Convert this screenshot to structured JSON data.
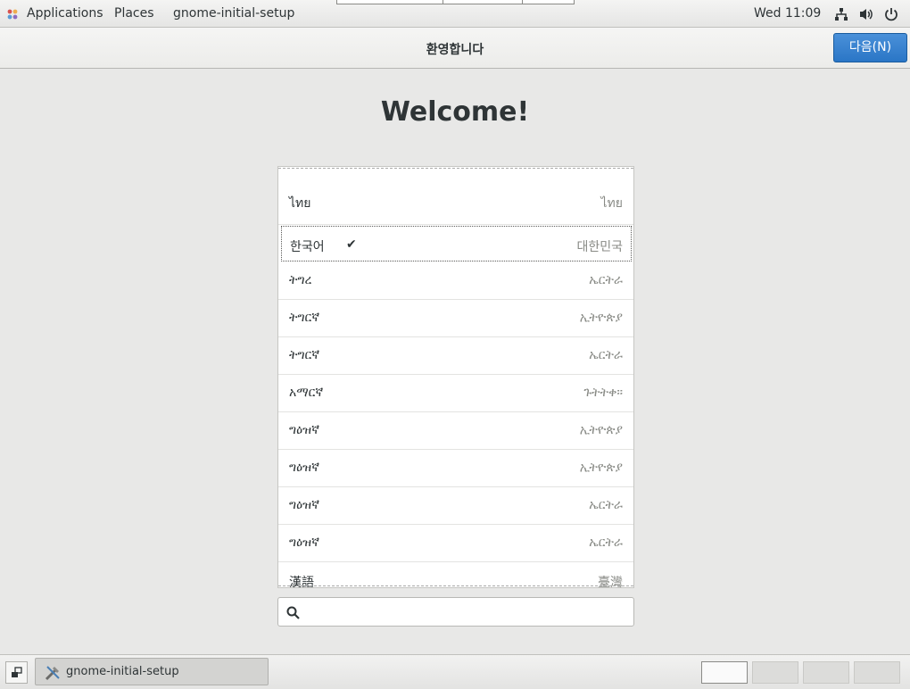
{
  "top_panel": {
    "applications": "Applications",
    "places": "Places",
    "app_name": "gnome-initial-setup",
    "clock": "Wed 11:09"
  },
  "header": {
    "title": "환영합니다",
    "next_button": "다음(N)"
  },
  "welcome": "Welcome!",
  "languages": [
    {
      "name": "ไทย",
      "region": "ไทย",
      "selected": false
    },
    {
      "name": "한국어",
      "region": "대한민국",
      "selected": true,
      "check": "✔"
    },
    {
      "name": "ትግረ",
      "region": "ኤርትራ",
      "selected": false
    },
    {
      "name": "ትግርኛ",
      "region": "ኢትዮጵያ",
      "selected": false
    },
    {
      "name": "ትግርኛ",
      "region": "ኤርትራ",
      "selected": false
    },
    {
      "name": "አማርኛ",
      "region": "ጉትትቀ።",
      "selected": false
    },
    {
      "name": "ግዕዝኛ",
      "region": "ኢትዮጵያ",
      "selected": false
    },
    {
      "name": "ግዕዝኛ",
      "region": "ኢትዮጵያ",
      "selected": false
    },
    {
      "name": "ግዕዝኛ",
      "region": "ኤርትራ",
      "selected": false
    },
    {
      "name": "ግዕዝኛ",
      "region": "ኤርትራ",
      "selected": false
    },
    {
      "name": "漢語",
      "region": "臺灣",
      "selected": false
    }
  ],
  "search": {
    "placeholder": ""
  },
  "taskbar": {
    "task_label": "gnome-initial-setup",
    "workspaces": 4,
    "active_workspace": 1
  },
  "colors": {
    "accent": "#2a76c6",
    "background": "#e8e8e7"
  }
}
